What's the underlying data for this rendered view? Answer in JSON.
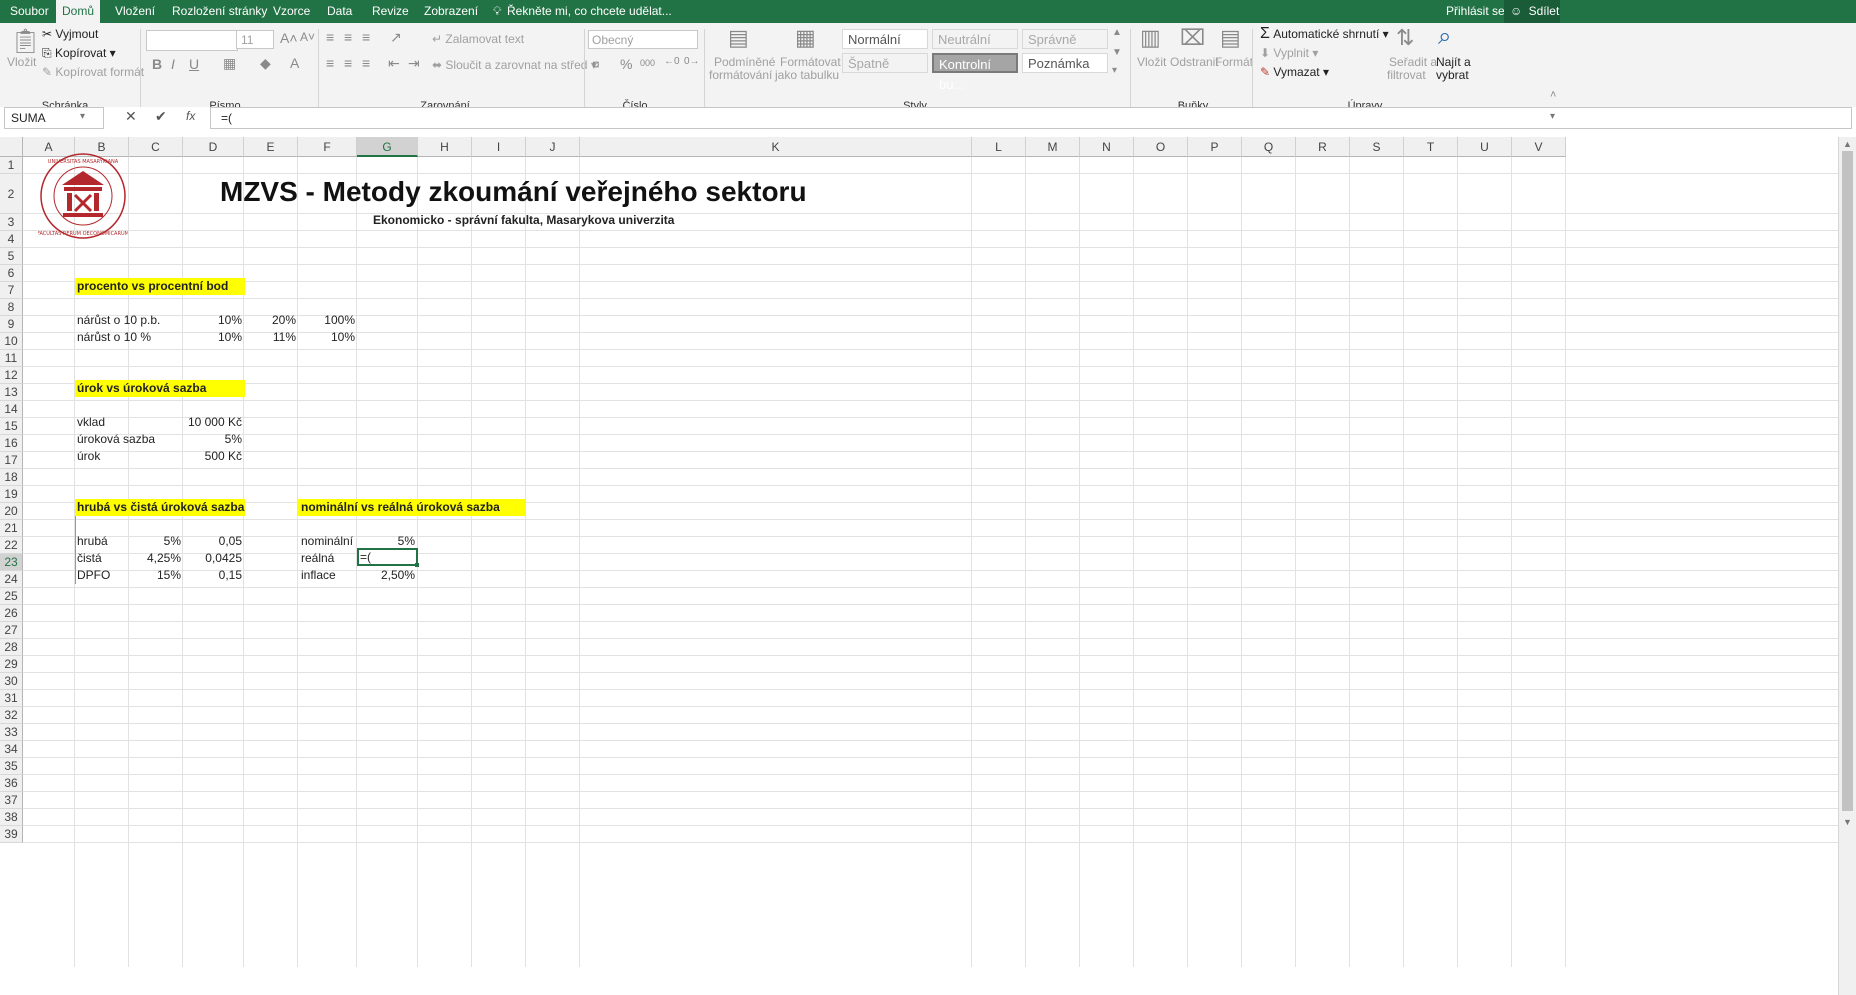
{
  "menu": {
    "tabs": [
      "Soubor",
      "Domů",
      "Vložení",
      "Rozložení stránky",
      "Vzorce",
      "Data",
      "Revize",
      "Zobrazení"
    ],
    "active_tab": "Domů",
    "tell_me": "Řekněte mi, co chcete udělat...",
    "sign_in": "Přihlásit se",
    "share": "Sdílet"
  },
  "ribbon": {
    "clipboard": {
      "paste": "Vložit",
      "cut": "Vyjmout",
      "copy": "Kopírovat",
      "format_painter": "Kopírovat formát",
      "group": "Schránka"
    },
    "font": {
      "font_name": "",
      "font_size": "11",
      "group": "Písmo",
      "bold": "B",
      "italic": "I",
      "underline": "U"
    },
    "alignment": {
      "wrap": "Zalamovat text",
      "merge": "Sloučit a zarovnat na střed",
      "group": "Zarovnání"
    },
    "number": {
      "format": "Obecný",
      "group": "Číslo",
      "percent": "%",
      "thousands": "000"
    },
    "styles": {
      "conditional_1": "Podmíněné",
      "conditional_2": "formátování",
      "format_table_1": "Formátovat",
      "format_table_2": "jako tabulku",
      "group": "Styly",
      "cells": [
        "Normální",
        "Neutrální",
        "Správně",
        "Špatně",
        "Kontrolní bu...",
        "Poznámka"
      ]
    },
    "cells": {
      "insert": "Vložit",
      "delete": "Odstranit",
      "format": "Formát",
      "group": "Buňky"
    },
    "editing": {
      "autosum": "Automatické shrnutí",
      "fill": "Vyplnit",
      "clear": "Vymazat",
      "sort_1": "Seřadit a",
      "sort_2": "filtrovat",
      "find_1": "Najít a",
      "find_2": "vybrat",
      "group": "Úpravy"
    }
  },
  "formula_bar": {
    "name_box": "SUMA",
    "formula": "=("
  },
  "columns": [
    "A",
    "B",
    "C",
    "D",
    "E",
    "F",
    "G",
    "H",
    "I",
    "J",
    "K",
    "L",
    "M",
    "N",
    "O",
    "P",
    "Q",
    "R",
    "S",
    "T",
    "U",
    "V"
  ],
  "selected_column": "G",
  "selected_row": "23",
  "sheet": {
    "title": "MZVS - Metody zkoumání veřejného sektoru",
    "subtitle": "Ekonomicko - správní fakulta, Masarykova univerzita",
    "logo_text": "UNIVERSITAS MASARYKIANA BRUNENSIS · FACULTAS RERUM OECONOMICARUM",
    "h1": "procento vs procentní bod",
    "r9": {
      "label": "nárůst o  10 p.b.",
      "d": "10%",
      "e": "20%",
      "f": "100%"
    },
    "r10": {
      "label": "nárůst  o  10 %",
      "d": "10%",
      "e": "11%",
      "f": "10%"
    },
    "h2": "úrok vs úroková sazba",
    "r15": {
      "label": "vklad",
      "d": "10 000 Kč"
    },
    "r16": {
      "label": "úroková sazba",
      "d": "5%"
    },
    "r17": {
      "label": "úrok",
      "d": "500 Kč"
    },
    "h3": "hrubá vs čistá úroková sazba",
    "h4": "nominální vs reálná úroková sazba",
    "r22": {
      "label": "hrubá",
      "c": "5%",
      "d": "0,05",
      "f": "nominální",
      "g": "5%"
    },
    "r23": {
      "label": "čistá",
      "c": "4,25%",
      "d": "0,0425",
      "f": "reálná",
      "g": "=("
    },
    "r24": {
      "label": "DPFO",
      "c": "15%",
      "d": "0,15",
      "f": "inflace",
      "g": "2,50%"
    }
  },
  "colors": {
    "excel_green": "#217346",
    "highlight": "#ffff00",
    "logo_red": "#b3282d"
  }
}
